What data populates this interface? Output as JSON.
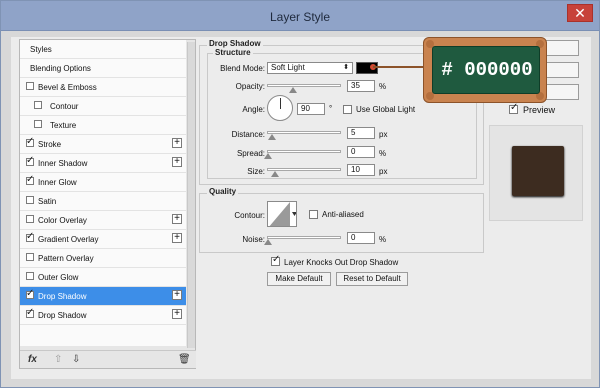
{
  "window": {
    "title": "Layer Style",
    "close_glyph": "✕"
  },
  "left_items": [
    {
      "label": "Styles"
    },
    {
      "label": "Blending Options"
    },
    {
      "label": "Bevel & Emboss",
      "checkbox": true,
      "checked": false
    },
    {
      "label": "Contour",
      "checkbox": true,
      "checked": false,
      "indent": true
    },
    {
      "label": "Texture",
      "checkbox": true,
      "checked": false,
      "indent": true
    },
    {
      "label": "Stroke",
      "checkbox": true,
      "checked": true,
      "plus": true
    },
    {
      "label": "Inner Shadow",
      "checkbox": true,
      "checked": true,
      "plus": true
    },
    {
      "label": "Inner Glow",
      "checkbox": true,
      "checked": true
    },
    {
      "label": "Satin",
      "checkbox": true,
      "checked": false
    },
    {
      "label": "Color Overlay",
      "checkbox": true,
      "checked": false,
      "plus": true
    },
    {
      "label": "Gradient Overlay",
      "checkbox": true,
      "checked": true,
      "plus": true
    },
    {
      "label": "Pattern Overlay",
      "checkbox": true,
      "checked": false
    },
    {
      "label": "Outer Glow",
      "checkbox": true,
      "checked": false
    },
    {
      "label": "Drop Shadow",
      "checkbox": true,
      "checked": true,
      "plus": true,
      "selected": true
    },
    {
      "label": "Drop Shadow",
      "checkbox": true,
      "checked": true,
      "plus": true
    }
  ],
  "left_footer": {
    "fx": "fx",
    "up": "⇧",
    "down": "⇩",
    "trash": "🗑"
  },
  "drop_shadow": {
    "section_title": "Drop Shadow",
    "structure_title": "Structure",
    "blend_mode_label": "Blend Mode:",
    "blend_mode_value": "Soft Light",
    "opacity_label": "Opacity:",
    "opacity_value": "35",
    "opacity_unit": "%",
    "opacity_level": 0.35,
    "angle_label": "Angle:",
    "angle_value": "90",
    "angle_unit": "°",
    "global_light_label": "Use Global Light",
    "global_light_checked": false,
    "distance_label": "Distance:",
    "distance_value": "5",
    "distance_unit": "px",
    "spread_label": "Spread:",
    "spread_value": "0",
    "spread_unit": "%",
    "size_label": "Size:",
    "size_value": "10",
    "size_unit": "px",
    "quality_title": "Quality",
    "contour_label": "Contour:",
    "anti_alias_label": "Anti-aliased",
    "anti_alias_checked": false,
    "noise_label": "Noise:",
    "noise_value": "0",
    "noise_unit": "%",
    "knockout_label": "Layer Knocks Out Drop Shadow",
    "knockout_checked": true,
    "make_default_label": "Make Default",
    "reset_default_label": "Reset to Default",
    "color_swatch": "#000000"
  },
  "preview": {
    "label": "Preview",
    "checked": true
  },
  "badge": {
    "text": "# 000000"
  }
}
